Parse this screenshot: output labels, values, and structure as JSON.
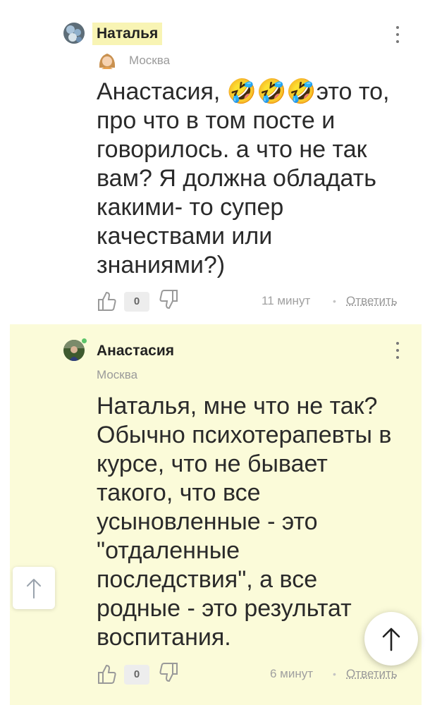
{
  "comments": [
    {
      "author": "Наталья",
      "city": "Москва",
      "text": "Анастасия, 🤣🤣🤣это то,\nпро что в том посте и\nговорилось. а что не так\nвам? Я должна обладать\nкакими- то супер\nкачествами или\nзнаниями?)",
      "likes": "0",
      "time": "11 минут",
      "reply": "Ответить"
    },
    {
      "author": "Анастасия",
      "city": "Москва",
      "text": "Наталья, мне что не так?\nОбычно психотерапевты в\nкурсе, что не бывает\nтакого, что все\nусыновленные - это\n\"отдаленные\nпоследствия\", а все\nродные - это результат\nвоспитания.",
      "likes": "0",
      "time": "6 минут",
      "reply": "Ответить"
    }
  ],
  "separator": "•",
  "colors": {
    "highlight_bg": "#fbfbd9",
    "author_highlight": "#f8f4b4",
    "online_dot": "#5cc46a"
  }
}
